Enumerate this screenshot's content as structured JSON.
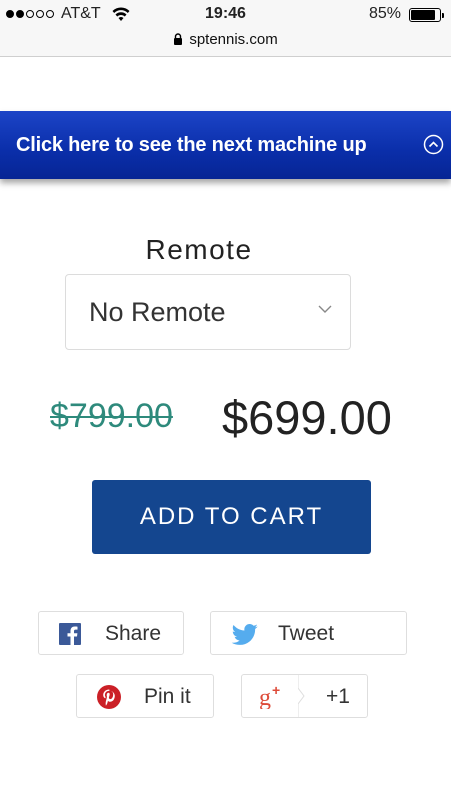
{
  "status_bar": {
    "carrier": "AT&T",
    "time": "19:46",
    "battery": "85%",
    "battery_level": 0.85,
    "signal_bars_filled": 2,
    "signal_bars_total": 5
  },
  "browser": {
    "url": "sptennis.com"
  },
  "banner": {
    "text": "Click here to see the next machine up",
    "icon": "chevron-up-circle-icon",
    "color": "#0a2ea9"
  },
  "product": {
    "option_label": "Remote",
    "select_value": "No Remote",
    "compare_price": "$799.00",
    "price": "$699.00",
    "add_to_cart_label": "ADD TO CART",
    "button_color": "#14468f",
    "compare_color": "#2e8a7c"
  },
  "share": {
    "facebook_label": "Share",
    "twitter_label": "Tweet",
    "pinterest_label": "Pin it",
    "google_plus_label": "+1"
  }
}
